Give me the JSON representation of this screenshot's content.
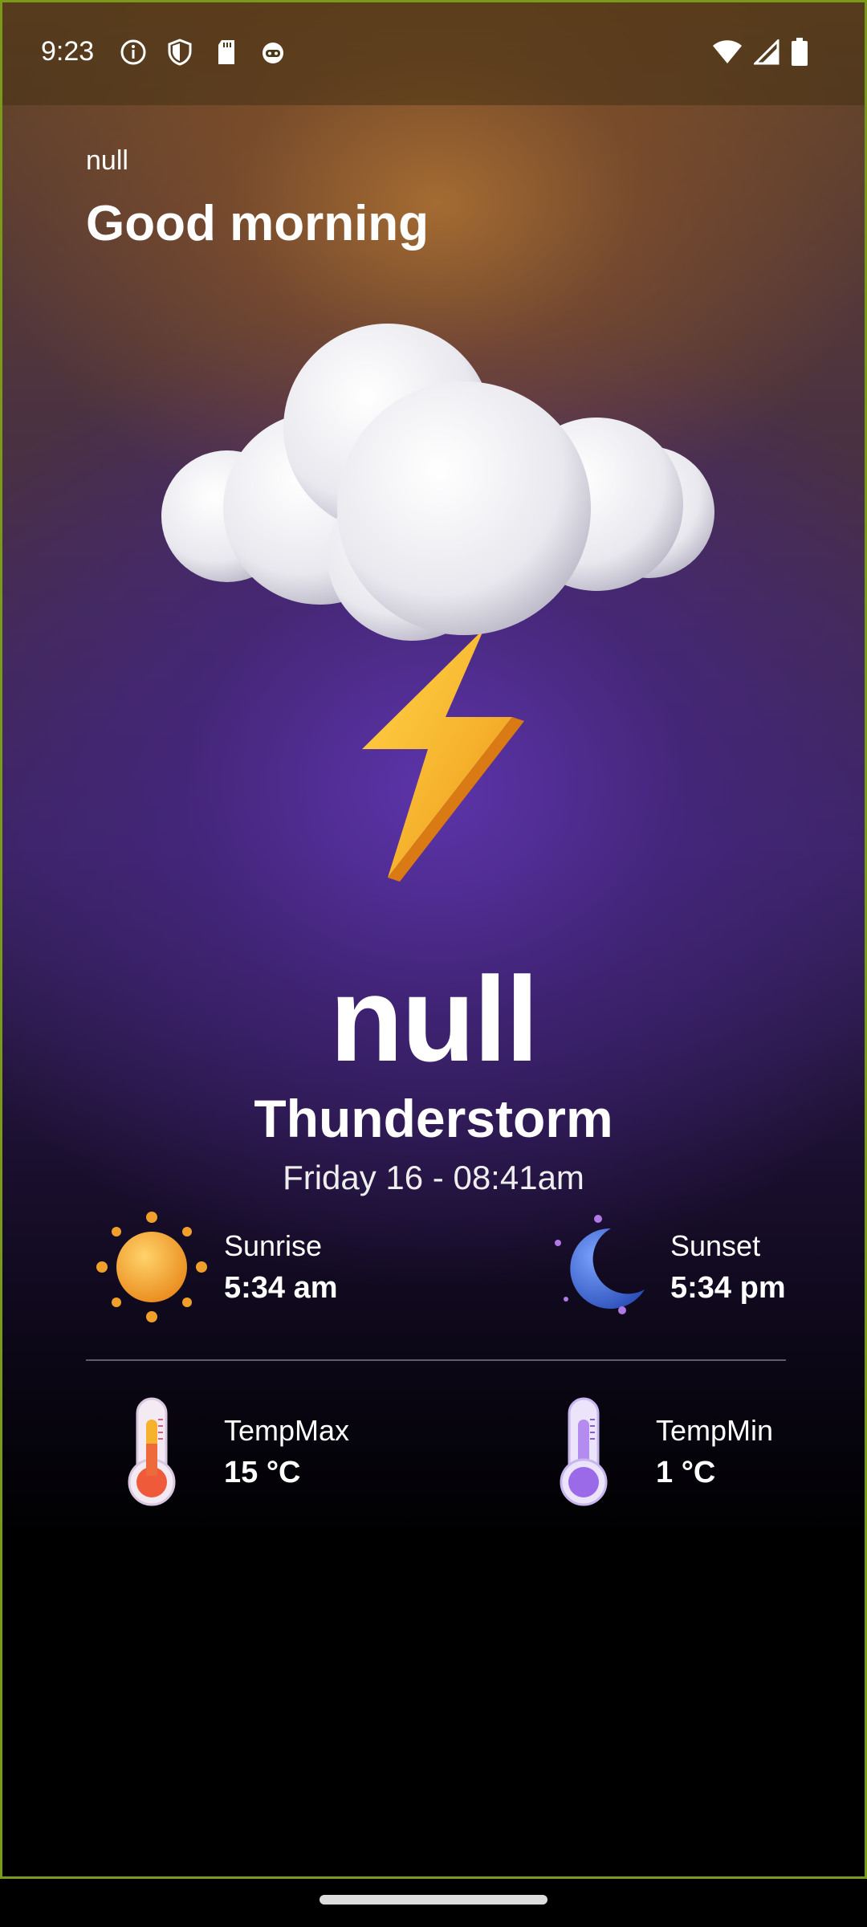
{
  "status_bar": {
    "time": "9:23",
    "left_icons": [
      "info-icon",
      "shield-icon",
      "sd-card-icon",
      "robot-icon"
    ],
    "right_icons": [
      "wifi-icon",
      "signal-icon",
      "battery-icon"
    ]
  },
  "header": {
    "user_name": "null",
    "greeting": "Good morning"
  },
  "weather": {
    "icon": "thunderstorm-icon",
    "temperature": "null",
    "condition": "Thunderstorm",
    "datetime": "Friday 16 - 08:41am"
  },
  "details": {
    "sunrise": {
      "label": "Sunrise",
      "value": "5:34 am",
      "icon": "sun-icon"
    },
    "sunset": {
      "label": "Sunset",
      "value": "5:34 pm",
      "icon": "moon-icon"
    },
    "temp_max": {
      "label": "TempMax",
      "value": "15 °C",
      "icon": "thermometer-hot-icon"
    },
    "temp_min": {
      "label": "TempMin",
      "value": "1 °C",
      "icon": "thermometer-cold-icon"
    }
  },
  "colors": {
    "accent_purple": "#5c34aa",
    "accent_brown": "#a86e32",
    "bolt_yellow": "#f6b22c"
  }
}
